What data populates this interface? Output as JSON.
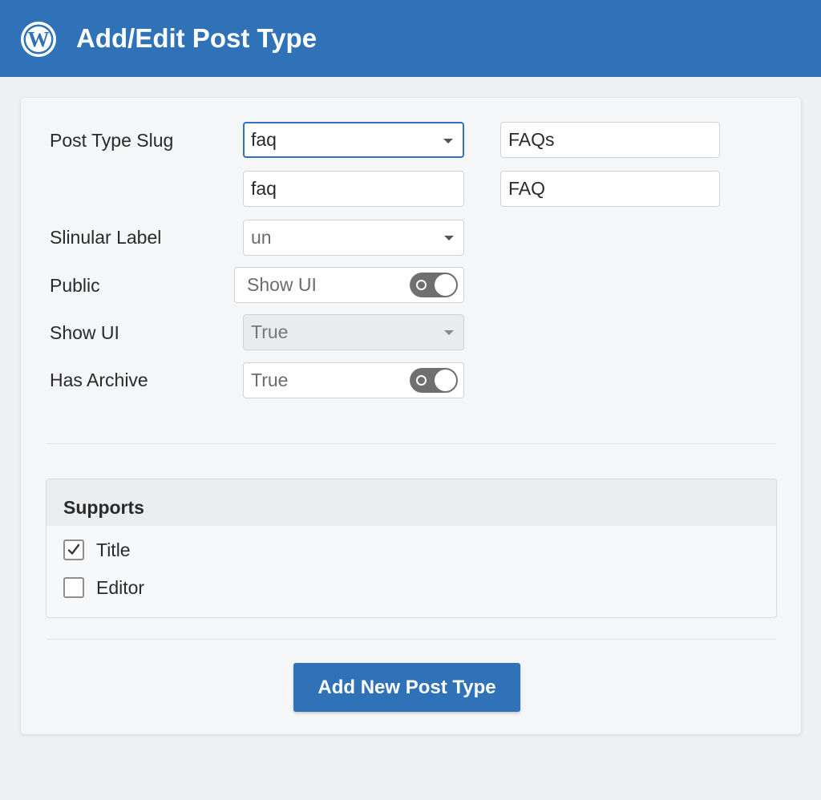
{
  "header": {
    "title": "Add/Edit Post Type",
    "logo_icon": "wordpress-logo-icon",
    "background_color": "#2f72b8"
  },
  "form": {
    "rows": [
      {
        "label": "Post Type Slug"
      },
      {
        "label": ""
      },
      {
        "label": "Slinular Label"
      },
      {
        "label": "Public"
      },
      {
        "label": "Show UI"
      },
      {
        "label": "Has Archive"
      }
    ],
    "slug_select": {
      "value": "faq"
    },
    "plural_label_input": {
      "value": "FAQs"
    },
    "slug_input": {
      "value": "faq"
    },
    "singular_label_input": {
      "value": "FAQ"
    },
    "singular_select": {
      "value": "un"
    },
    "public_field": {
      "value": "Show UI",
      "toggle_on": true
    },
    "show_ui_select": {
      "value": "True",
      "disabled": true
    },
    "has_archive_field": {
      "value": "True",
      "toggle_on": true
    }
  },
  "supports": {
    "title": "Supports",
    "items": [
      {
        "label": "Title",
        "checked": true
      },
      {
        "label": "Editor",
        "checked": false
      }
    ]
  },
  "actions": {
    "submit_label": "Add New Post Type"
  },
  "colors": {
    "accent": "#2f72b8",
    "page_background": "#eef0f3",
    "card_background": "#f5f6f7"
  }
}
